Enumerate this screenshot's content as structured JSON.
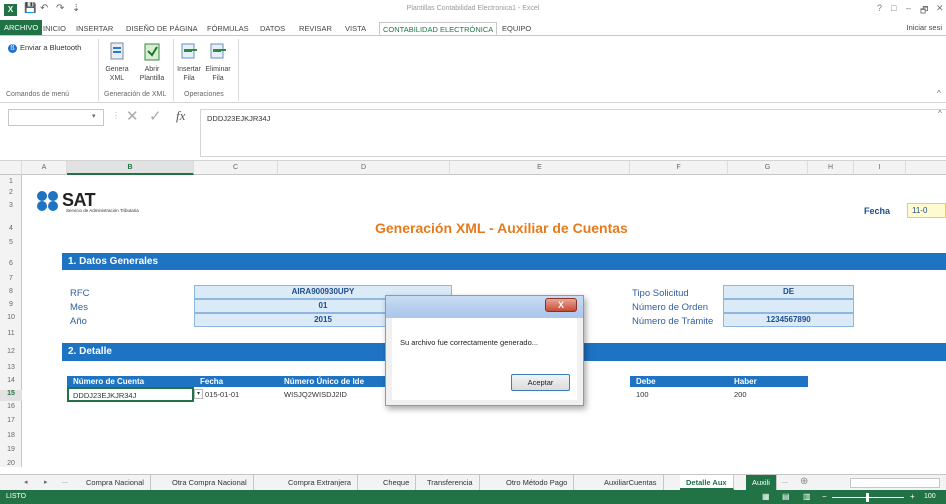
{
  "window": {
    "title": "Plantillas Contabilidad Electronica1 - Excel",
    "help": "?",
    "restore": "□",
    "minimize": "–",
    "maximize": "🗗",
    "close": "✕"
  },
  "quick_access": {
    "save": "💾",
    "undo": "↶",
    "redo": "↷",
    "more": "⇣"
  },
  "ribbon_tabs": [
    {
      "label": "ARCHIVO"
    },
    {
      "label": "INICIO"
    },
    {
      "label": "INSERTAR"
    },
    {
      "label": "DISEÑO DE PÁGINA"
    },
    {
      "label": "FÓRMULAS"
    },
    {
      "label": "DATOS"
    },
    {
      "label": "REVISAR"
    },
    {
      "label": "VISTA"
    },
    {
      "label": "CONTABILIDAD ELECTRÓNICA"
    },
    {
      "label": "EQUIPO"
    }
  ],
  "signin": "Iniciar sesi",
  "ribbon": {
    "bluetooth": "Enviar a Bluetooth",
    "genera_xml": [
      "Genera",
      "XML"
    ],
    "abrir_plantilla": [
      "Abrir",
      "Plantilla"
    ],
    "insertar_fila": [
      "Insertar",
      "Fila"
    ],
    "eliminar_fila": [
      "Eliminar",
      "Fila"
    ],
    "groups": [
      "Comandos de menú",
      "Generación de XML",
      "Operaciones"
    ],
    "collapse": "^"
  },
  "formula_bar": {
    "name_box": "",
    "cancel": "✕",
    "enter": "✓",
    "fx": "fx",
    "value": "DDDJ23EJKJR34J",
    "expand": "^"
  },
  "columns": [
    "A",
    "B",
    "C",
    "D",
    "E",
    "F",
    "G",
    "H",
    "I"
  ],
  "rows": [
    "1",
    "2",
    "3",
    "4",
    "5",
    "6",
    "7",
    "8",
    "9",
    "10",
    "11",
    "12",
    "13",
    "14",
    "15",
    "16",
    "17",
    "18",
    "19",
    "20"
  ],
  "sheet": {
    "logo": "SAT",
    "logo_sub": "Servicio de Administración Tributaria",
    "title": "Generación XML - Auxiliar de Cuentas",
    "fecha_label": "Fecha",
    "fecha_value": "11-0",
    "section1": "1. Datos Generales",
    "rfc_label": "RFC",
    "rfc": "AIRA900930UPY",
    "mes_label": "Mes",
    "mes": "01",
    "anio_label": "Año",
    "anio": "2015",
    "tipo_label": "Tipo Solicitud",
    "tipo": "DE",
    "orden_label": "Número de Orden",
    "orden": "",
    "tramite_label": "Número de Trámite",
    "tramite": "1234567890",
    "section2": "2. Detalle",
    "headers": [
      "Número de Cuenta",
      "Fecha",
      "Número Único de Ide",
      "Debe",
      "Haber"
    ],
    "row": [
      "DDDJ23EJKJR34J",
      "015-01-01",
      "WISJQ2WISDJ2ID",
      "100",
      "200"
    ]
  },
  "dialog": {
    "close": "X",
    "message": "Su archivo fue correctamente generado...",
    "ok": "Aceptar"
  },
  "sheet_tabs": {
    "nav_prev": "◂",
    "nav_next": "▸",
    "ellipsis": "...",
    "tabs": [
      "Compra Nacional",
      "Otra Compra Nacional",
      "Compra Extranjera",
      "Cheque",
      "Transferencia",
      "Otro Método Pago",
      "AuxiliarCuentas",
      "Detalle Aux",
      "Auxili"
    ],
    "more": "...",
    "add": "⊕"
  },
  "status": {
    "text": "LISTO",
    "zoom": "100"
  },
  "colors": {
    "excel_green": "#217346",
    "band_blue": "#1f73c3",
    "title_orange": "#e57b1c"
  }
}
